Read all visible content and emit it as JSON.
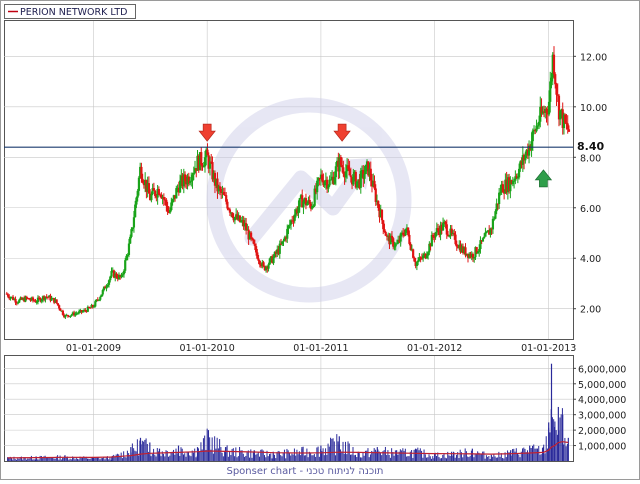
{
  "chart_data": [
    {
      "type": "candlestick",
      "legend": "PERION NETWORK LTD",
      "x_tick_labels": [
        "01-01-2009",
        "01-01-2010",
        "01-01-2011",
        "01-01-2012",
        "01-01-2013"
      ],
      "x_range": [
        "2008-03-20",
        "2013-03-20"
      ],
      "y_tick_labels": [
        "2.00",
        "4.00",
        "6.00",
        "8.00",
        "10.00",
        "12.00"
      ],
      "ylim": [
        0.8,
        13.4
      ],
      "grid": true,
      "horizontal_line": {
        "value": 8.4,
        "label": "8.40",
        "color": "#1a3a6e"
      },
      "markers": [
        {
          "type": "down-arrow",
          "date": "2010-01-01",
          "y": 8.6,
          "color": "#ef4030"
        },
        {
          "type": "down-arrow",
          "date": "2011-03-10",
          "y": 8.6,
          "color": "#ef4030"
        },
        {
          "type": "up-arrow",
          "date": "2012-12-15",
          "y": 7.5,
          "color": "#2f9e4a"
        }
      ],
      "colors": {
        "up": "#1aa31a",
        "down": "#e01414"
      },
      "series": [
        {
          "x": [
            "2008-03-25",
            "2008-05-01",
            "2008-06-01",
            "2008-07-01",
            "2008-08-01",
            "2008-09-01",
            "2008-10-01",
            "2008-11-01",
            "2008-12-01",
            "2009-01-01",
            "2009-02-01",
            "2009-03-01",
            "2009-04-01",
            "2009-05-01",
            "2009-06-01",
            "2009-07-01",
            "2009-08-01",
            "2009-09-01",
            "2009-10-01",
            "2009-11-01",
            "2009-12-01",
            "2010-01-01",
            "2010-02-01",
            "2010-03-01",
            "2010-04-01",
            "2010-05-01",
            "2010-06-01",
            "2010-07-01",
            "2010-08-01",
            "2010-09-01",
            "2010-10-01",
            "2010-11-01",
            "2010-12-01",
            "2011-01-01",
            "2011-02-01",
            "2011-03-01",
            "2011-04-01",
            "2011-05-01",
            "2011-06-01",
            "2011-07-01",
            "2011-08-01",
            "2011-09-01",
            "2011-10-01",
            "2011-11-01",
            "2011-12-01",
            "2012-01-01",
            "2012-02-01",
            "2012-03-01",
            "2012-04-01",
            "2012-05-01",
            "2012-06-01",
            "2012-07-01",
            "2012-08-01",
            "2012-09-01",
            "2012-10-01",
            "2012-11-01",
            "2012-12-01",
            "2013-01-01",
            "2013-01-15",
            "2013-02-01",
            "2013-02-20",
            "2013-03-10"
          ],
          "y": [
            2.6,
            2.3,
            2.4,
            2.3,
            2.5,
            2.3,
            1.7,
            1.8,
            1.9,
            2.1,
            2.7,
            3.4,
            3.2,
            4.8,
            7.6,
            6.4,
            6.8,
            5.8,
            6.9,
            7.2,
            7.8,
            8.0,
            6.8,
            6.3,
            5.6,
            5.3,
            4.4,
            3.6,
            4.0,
            4.6,
            5.6,
            6.3,
            6.1,
            7.2,
            7.0,
            7.8,
            7.3,
            7.0,
            7.6,
            6.2,
            4.8,
            4.5,
            5.2,
            3.8,
            4.1,
            5.0,
            5.3,
            4.8,
            4.3,
            4.1,
            4.6,
            5.2,
            6.8,
            7.0,
            7.6,
            8.5,
            9.5,
            10.1,
            12.1,
            10.0,
            9.3,
            9.0
          ]
        }
      ]
    },
    {
      "type": "bar",
      "y_tick_labels": [
        "1,000,000",
        "2,000,000",
        "3,000,000",
        "4,000,000",
        "5,000,000",
        "6,000,000"
      ],
      "ylim": [
        0,
        6800000
      ],
      "grid": true,
      "bar_color": "#2a2a9a",
      "average_color": "#c02030",
      "series": [
        {
          "x": [
            "2008-04-01",
            "2008-07-01",
            "2008-10-01",
            "2009-01-01",
            "2009-03-01",
            "2009-05-01",
            "2009-06-01",
            "2009-07-01",
            "2009-08-01",
            "2009-10-01",
            "2009-12-01",
            "2010-01-05",
            "2010-03-01",
            "2010-06-01",
            "2010-08-01",
            "2010-11-01",
            "2011-01-01",
            "2011-03-01",
            "2011-05-01",
            "2011-07-01",
            "2011-09-01",
            "2011-11-01",
            "2012-01-01",
            "2012-03-01",
            "2012-05-01",
            "2012-07-01",
            "2012-09-01",
            "2012-11-01",
            "2012-12-15",
            "2013-01-01",
            "2013-01-10",
            "2013-01-20",
            "2013-02-01",
            "2013-02-15",
            "2013-03-05"
          ],
          "values": [
            250000,
            300000,
            350000,
            250000,
            300000,
            900000,
            1500000,
            1200000,
            800000,
            1000000,
            900000,
            2000000,
            900000,
            700000,
            600000,
            800000,
            1000000,
            1600000,
            600000,
            900000,
            700000,
            800000,
            500000,
            600000,
            800000,
            400000,
            700000,
            1000000,
            900000,
            2500000,
            6300000,
            2200000,
            3500000,
            3000000,
            1500000
          ],
          "average": [
            200000,
            220000,
            240000,
            230000,
            260000,
            350000,
            450000,
            500000,
            520000,
            560000,
            600000,
            650000,
            620000,
            580000,
            540000,
            520000,
            530000,
            570000,
            560000,
            540000,
            520000,
            500000,
            480000,
            470000,
            460000,
            450000,
            470000,
            520000,
            560000,
            700000,
            900000,
            1000000,
            1200000,
            1250000,
            1200000
          ]
        }
      ]
    }
  ],
  "footer_text": "Sponser chart - תוכנה לניתוח טכני"
}
